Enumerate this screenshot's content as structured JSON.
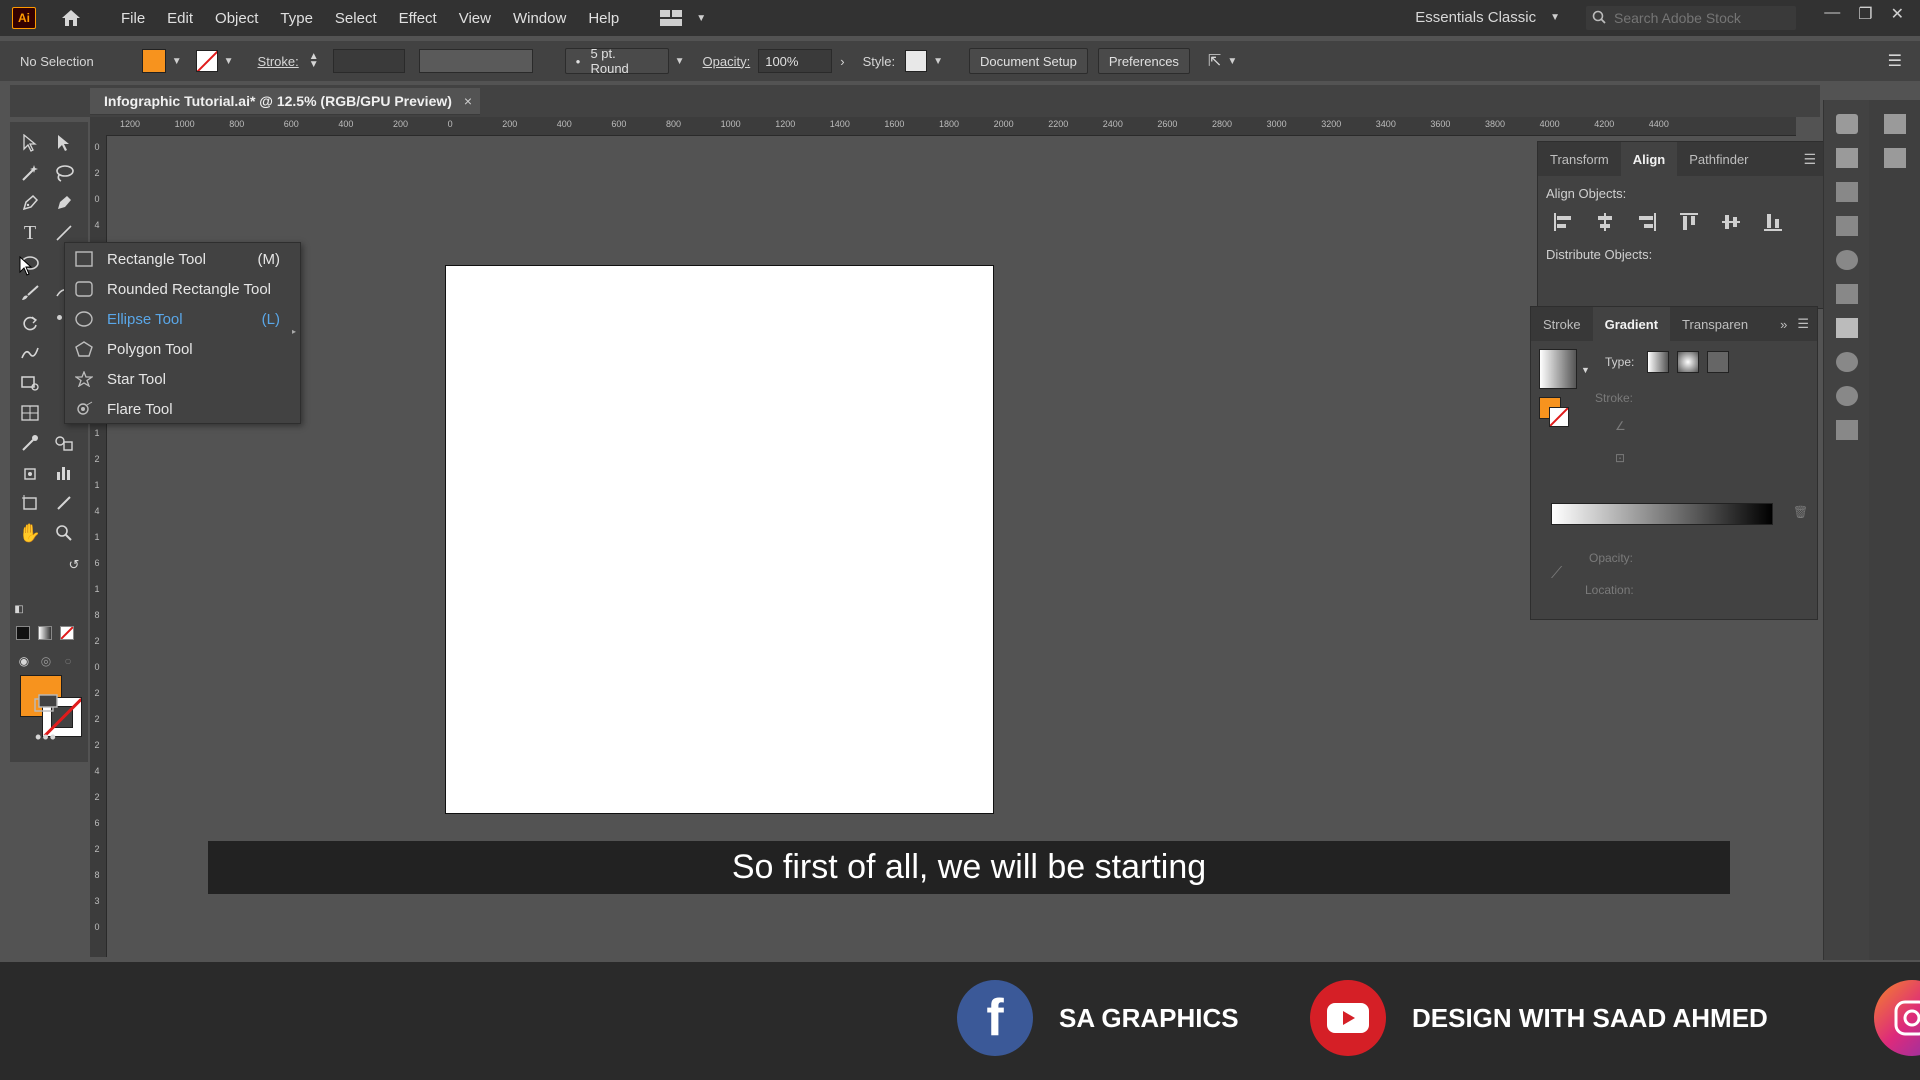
{
  "app": {
    "logo": "Ai",
    "menu": [
      "File",
      "Edit",
      "Object",
      "Type",
      "Select",
      "Effect",
      "View",
      "Window",
      "Help"
    ],
    "workspace": "Essentials Classic",
    "search_placeholder": "Search Adobe Stock"
  },
  "control_bar": {
    "selection": "No Selection",
    "stroke_label": "Stroke:",
    "brush": "5 pt. Round",
    "opacity_label": "Opacity:",
    "opacity_value": "100%",
    "style_label": "Style:",
    "document_setup": "Document Setup",
    "preferences": "Preferences"
  },
  "document": {
    "tab_title": "Infographic Tutorial.ai* @ 12.5% (RGB/GPU Preview)",
    "close": "×"
  },
  "ruler": {
    "h_ticks": [
      "1200",
      "1000",
      "800",
      "600",
      "400",
      "200",
      "0",
      "200",
      "400",
      "600",
      "800",
      "1000",
      "1200",
      "1400",
      "1600",
      "1800",
      "2000",
      "2200",
      "2400",
      "2600",
      "2800",
      "3000",
      "3200",
      "3400",
      "3600",
      "3800",
      "4000",
      "4200",
      "4400"
    ],
    "v_ticks": [
      "0",
      "2",
      "0",
      "4",
      "0",
      "6",
      "0",
      "8",
      "0",
      "1",
      "0",
      "1",
      "2",
      "1",
      "4",
      "1",
      "6",
      "1",
      "8",
      "2",
      "0",
      "2",
      "2",
      "2",
      "4",
      "2",
      "6",
      "2",
      "8",
      "3",
      "0"
    ]
  },
  "flyout": {
    "items": [
      {
        "label": "Rectangle Tool",
        "shortcut": "(M)",
        "icon": "rectangle-icon"
      },
      {
        "label": "Rounded Rectangle Tool",
        "shortcut": "",
        "icon": "rounded-rectangle-icon"
      },
      {
        "label": "Ellipse Tool",
        "shortcut": "(L)",
        "icon": "ellipse-icon",
        "active": true
      },
      {
        "label": "Polygon Tool",
        "shortcut": "",
        "icon": "polygon-icon"
      },
      {
        "label": "Star Tool",
        "shortcut": "",
        "icon": "star-icon"
      },
      {
        "label": "Flare Tool",
        "shortcut": "",
        "icon": "flare-icon"
      }
    ]
  },
  "subtitle": "So first of all, we will be starting",
  "align_panel": {
    "tabs": [
      "Transform",
      "Align",
      "Pathfinder"
    ],
    "align_objects": "Align Objects:",
    "distribute_objects": "Distribute Objects:"
  },
  "gradient_panel": {
    "tabs": [
      "Stroke",
      "Gradient",
      "Transparen"
    ],
    "type_label": "Type:",
    "stroke_label": "Stroke:",
    "opacity_label": "Opacity:",
    "location_label": "Location:"
  },
  "footer": {
    "facebook": "SA GRAPHICS",
    "youtube": "DESIGN WITH SAAD AHMED"
  },
  "colors": {
    "fill": "#f7931e",
    "accent_blue": "#5aa7e8",
    "facebook": "#3b5998",
    "youtube": "#d51f26"
  }
}
